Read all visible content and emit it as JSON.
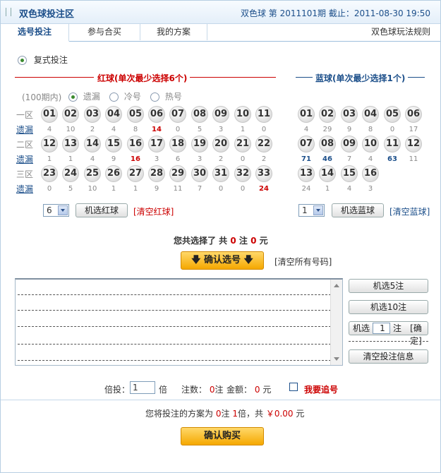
{
  "header": {
    "title": "双色球投注区",
    "issue_text": "双色球 第 2011101期 截止：2011-08-30 19:50"
  },
  "tabs": [
    {
      "label": "选号投注",
      "active": true
    },
    {
      "label": "参与合买",
      "active": false
    },
    {
      "label": "我的方案",
      "active": false
    }
  ],
  "rules_link": "双色球玩法规则",
  "mode": {
    "label": "复式投注",
    "selected": true
  },
  "red_section": {
    "title": "红球(单次最少选择6个)"
  },
  "blue_section": {
    "title": "蓝球(单次最少选择1个)"
  },
  "stats_options": {
    "period": "(100期内)",
    "options": [
      {
        "label": "遗漏",
        "selected": true
      },
      {
        "label": "冷号",
        "selected": false
      },
      {
        "label": "热号",
        "selected": false
      }
    ]
  },
  "zone_labels": [
    "一区",
    "二区",
    "三区"
  ],
  "miss_label": "遗漏",
  "red_rows": [
    {
      "balls": [
        "01",
        "02",
        "03",
        "04",
        "05",
        "06",
        "07",
        "08",
        "09",
        "10",
        "11"
      ],
      "miss": [
        "4",
        "10",
        "2",
        "4",
        "8",
        "14",
        "0",
        "5",
        "3",
        "1",
        "0"
      ],
      "hot_index": [
        5
      ]
    },
    {
      "balls": [
        "12",
        "13",
        "14",
        "15",
        "16",
        "17",
        "18",
        "19",
        "20",
        "21",
        "22"
      ],
      "miss": [
        "1",
        "1",
        "4",
        "9",
        "16",
        "3",
        "6",
        "3",
        "2",
        "0",
        "2"
      ],
      "hot_index": [
        4
      ]
    },
    {
      "balls": [
        "23",
        "24",
        "25",
        "26",
        "27",
        "28",
        "29",
        "30",
        "31",
        "32",
        "33"
      ],
      "miss": [
        "0",
        "5",
        "10",
        "1",
        "1",
        "9",
        "11",
        "7",
        "0",
        "0",
        "24"
      ],
      "hot_index": [
        10
      ]
    }
  ],
  "blue_rows": [
    {
      "balls": [
        "01",
        "02",
        "03",
        "04",
        "05",
        "06"
      ],
      "miss": [
        "4",
        "29",
        "9",
        "8",
        "0",
        "17"
      ],
      "hot_index": []
    },
    {
      "balls": [
        "07",
        "08",
        "09",
        "10",
        "11",
        "12"
      ],
      "miss": [
        "71",
        "46",
        "7",
        "4",
        "63",
        "11"
      ],
      "hot_index": [
        0,
        1,
        4
      ]
    },
    {
      "balls": [
        "13",
        "14",
        "15",
        "16"
      ],
      "miss": [
        "24",
        "1",
        "4",
        "3"
      ],
      "hot_index": []
    }
  ],
  "red_controls": {
    "count": "6",
    "random_button": "机选红球",
    "clear_link": "[清空红球]"
  },
  "blue_controls": {
    "count": "1",
    "random_button": "机选蓝球",
    "clear_link": "[清空蓝球]"
  },
  "summary": {
    "prefix": "您共选择了 共",
    "notes": "0",
    "notes_unit": "注",
    "yuan": "0",
    "yuan_unit": "元"
  },
  "confirm_button": "确认选号",
  "clear_all_link": "[清空所有号码]",
  "side_buttons": {
    "random5": "机选5注",
    "random10": "机选10注",
    "random_n_prefix": "机选",
    "random_n_value": "1",
    "random_n_unit": "注",
    "random_n_confirm": "[确定]",
    "clear_bets": "清空投注信息"
  },
  "multiplier": {
    "label": "倍投：",
    "value": "1",
    "unit": "倍"
  },
  "bet_count": {
    "label": "注数：",
    "value": "0",
    "unit": "注"
  },
  "amount": {
    "label": "金额：",
    "value": "0",
    "unit": "元"
  },
  "chase": {
    "label": "我要追号",
    "checked": false
  },
  "final_summary": {
    "p1": "您将投注的方案为",
    "notes": "0",
    "p2": "注",
    "multi": "1",
    "p3": "倍，共",
    "amount": "￥0.00",
    "p4": "元"
  },
  "buy_button": "确认购买",
  "colors": {
    "red": "#cc0000",
    "blue": "#1c4f8a",
    "orange": "#f5a800"
  }
}
